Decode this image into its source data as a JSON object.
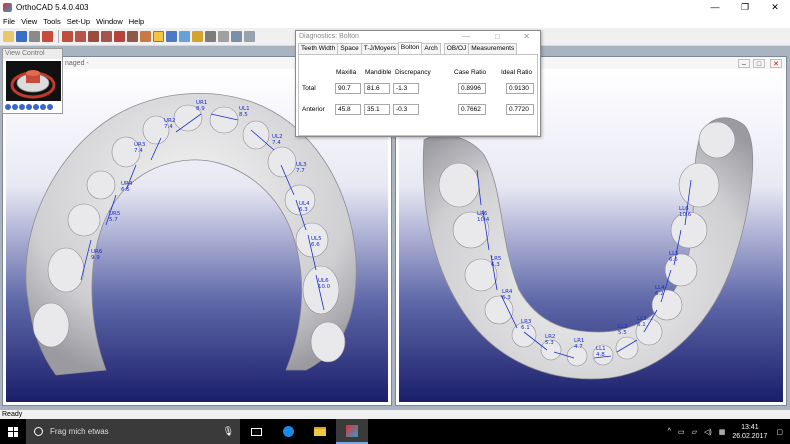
{
  "app": {
    "title": "OrthoCAD 5.4.0.403"
  },
  "window_controls": {
    "minimize": "—",
    "restore": "❐",
    "close": "✕"
  },
  "menu": [
    "File",
    "View",
    "Tools",
    "Set-Up",
    "Window",
    "Help"
  ],
  "view_control": {
    "title": "View Control"
  },
  "left_window": {
    "title_fragment": "naged -"
  },
  "diagnostics": {
    "title": "Diagnostics: Bolton",
    "tabs": [
      "Teeth Width",
      "Space",
      "T-J/Moyers",
      "Bolton",
      "Arch",
      "OB/OJ",
      "Measurements"
    ],
    "active_tab": "Bolton",
    "headers": {
      "maxilla": "Maxilla",
      "mandible": "Mandible",
      "discrepancy": "Discrepancy",
      "case_ratio": "Case Ratio",
      "ideal_ratio": "Ideal Ratio"
    },
    "rows": [
      {
        "label": "Total",
        "maxilla": "90.7",
        "mandible": "81.6",
        "discrepancy": "-1.3",
        "case_ratio": "0.8996",
        "ideal_ratio": "0.9130"
      },
      {
        "label": "Anterior",
        "maxilla": "45.8",
        "mandible": "35.1",
        "discrepancy": "-0.3",
        "case_ratio": "0.7662",
        "ideal_ratio": "0.7720"
      }
    ]
  },
  "upper_labels": [
    {
      "tooth": "UL1",
      "value": "8.5"
    },
    {
      "tooth": "UR1",
      "value": "8.9"
    },
    {
      "tooth": "UR2",
      "value": "7.4"
    },
    {
      "tooth": "UR3",
      "value": "7.4"
    },
    {
      "tooth": "UL2",
      "value": "7.4"
    },
    {
      "tooth": "UL3",
      "value": "7.7"
    },
    {
      "tooth": "UR4",
      "value": "6.5"
    },
    {
      "tooth": "UL4",
      "value": "6.3"
    },
    {
      "tooth": "UR5",
      "value": "5.7"
    },
    {
      "tooth": "UL5",
      "value": "6.6"
    },
    {
      "tooth": "UR6",
      "value": "9.9"
    },
    {
      "tooth": "UL6",
      "value": "10.0"
    }
  ],
  "lower_labels": [
    {
      "tooth": "LR6",
      "value": "10.4"
    },
    {
      "tooth": "LL6",
      "value": "10.6"
    },
    {
      "tooth": "LR5",
      "value": "6.3"
    },
    {
      "tooth": "LL5",
      "value": "6.6"
    },
    {
      "tooth": "LR4",
      "value": "6.3"
    },
    {
      "tooth": "LL4",
      "value": "6.2"
    },
    {
      "tooth": "LR3",
      "value": "6.1"
    },
    {
      "tooth": "LL3",
      "value": "6.1"
    },
    {
      "tooth": "LR2",
      "value": "5.3"
    },
    {
      "tooth": "LL2",
      "value": "5.5"
    },
    {
      "tooth": "LR1",
      "value": "4.7"
    },
    {
      "tooth": "LL1",
      "value": "4.8"
    }
  ],
  "status": {
    "text": "Ready"
  },
  "taskbar": {
    "search_placeholder": "Frag mich etwas",
    "time": "13:41",
    "date": "26.02.2017"
  },
  "colors": {
    "label_blue": "#1a2ecf",
    "viewport_dark": "#1b1f6b"
  }
}
